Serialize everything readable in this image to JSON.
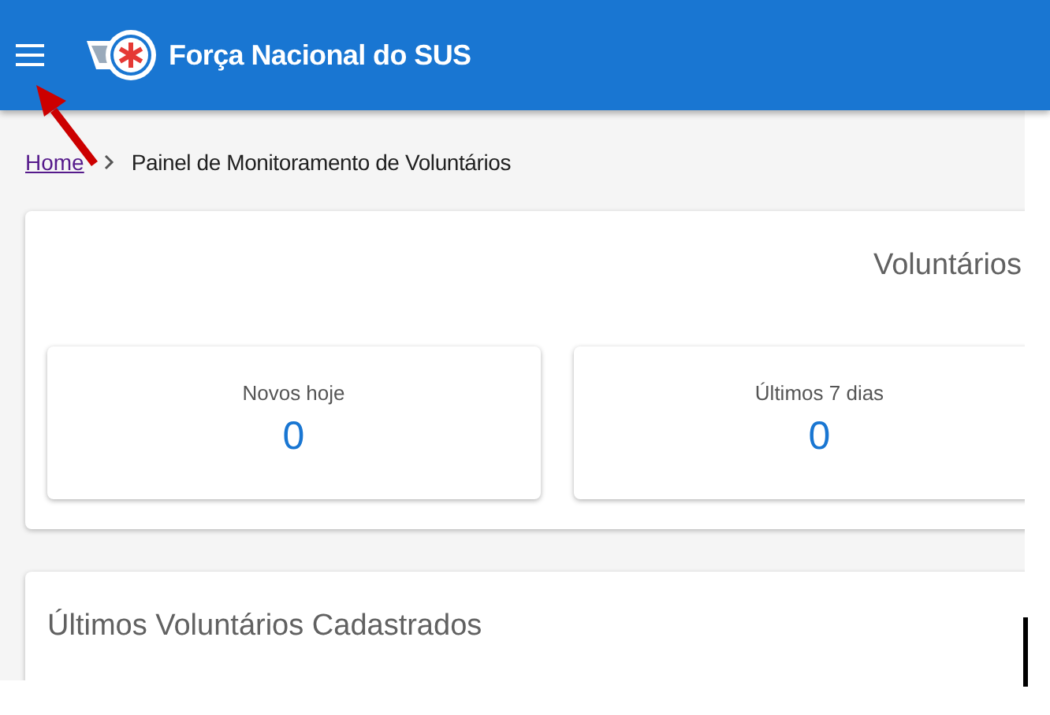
{
  "header": {
    "title": "Força Nacional do SUS"
  },
  "breadcrumb": [
    {
      "label": "Home",
      "kind": "link"
    },
    {
      "label": "Painel de Monitoramento de Voluntários",
      "kind": "current"
    }
  ],
  "volunteers_panel": {
    "title": "Voluntários",
    "stats": [
      {
        "label": "Novos hoje",
        "value": "0"
      },
      {
        "label": "Últimos 7 dias",
        "value": "0"
      }
    ]
  },
  "recent_panel": {
    "title": "Últimos Voluntários Cadastrados"
  }
}
